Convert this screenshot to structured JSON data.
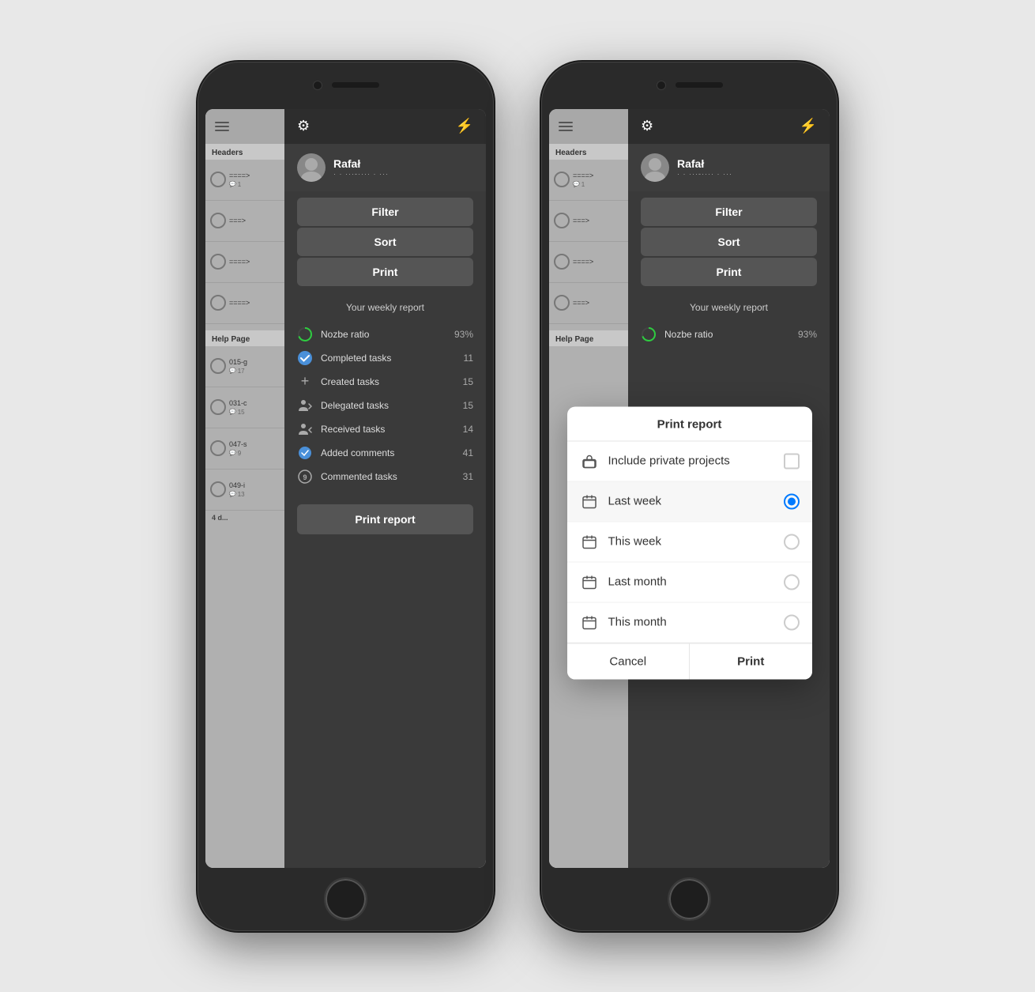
{
  "phone1": {
    "header": {
      "gear_label": "⚙",
      "lightning_label": "⚡"
    },
    "user": {
      "name": "Rafał",
      "email": "· · ···-···· · ···"
    },
    "menu": {
      "filter_label": "Filter",
      "sort_label": "Sort",
      "print_label": "Print"
    },
    "sidebar": {
      "headers_label": "Headers",
      "help_label": "Help Page",
      "items": [
        {
          "title": "====>",
          "count": "1"
        },
        {
          "title": "===>",
          "count": ""
        },
        {
          "title": "====>",
          "count": ""
        },
        {
          "title": "====>",
          "count": ""
        }
      ],
      "bottom_items": [
        {
          "title": "015-g",
          "count": "17"
        },
        {
          "title": "031-c",
          "count": "15"
        },
        {
          "title": "047-s",
          "count": "9"
        },
        {
          "title": "049-i",
          "count": "13"
        }
      ],
      "footer": "4 d..."
    },
    "report": {
      "title": "Your weekly report",
      "items": [
        {
          "icon": "circle-progress",
          "label": "Nozbe ratio",
          "count": "93%",
          "type": "progress"
        },
        {
          "icon": "check",
          "label": "Completed tasks",
          "count": "11",
          "type": "check"
        },
        {
          "icon": "plus",
          "label": "Created tasks",
          "count": "15",
          "type": "plus"
        },
        {
          "icon": "delegate",
          "label": "Delegated tasks",
          "count": "15",
          "type": "person"
        },
        {
          "icon": "receive",
          "label": "Received tasks",
          "count": "14",
          "type": "person-in"
        },
        {
          "icon": "comment-check",
          "label": "Added comments",
          "count": "41",
          "type": "comment-check"
        },
        {
          "icon": "comment",
          "label": "Commented tasks",
          "count": "31",
          "type": "comment-num"
        }
      ],
      "print_report_label": "Print report"
    }
  },
  "phone2": {
    "header": {
      "gear_label": "⚙",
      "lightning_label": "⚡"
    },
    "user": {
      "name": "Rafał",
      "email": "· · ···-···· · ···"
    },
    "menu": {
      "filter_label": "Filter",
      "sort_label": "Sort",
      "print_label": "Print"
    },
    "sidebar": {
      "headers_label": "Headers",
      "help_label": "Help Page",
      "items": [
        {
          "title": "====>",
          "count": "1"
        },
        {
          "title": "===>",
          "count": ""
        },
        {
          "title": "====>",
          "count": ""
        },
        {
          "title": "====>",
          "count": ""
        }
      ]
    },
    "report": {
      "title": "Your weekly report",
      "nozbe_ratio": "93%"
    },
    "dialog": {
      "title": "Print report",
      "include_private": "Include private projects",
      "options": [
        {
          "label": "Last week",
          "selected": true
        },
        {
          "label": "This week",
          "selected": false
        },
        {
          "label": "Last month",
          "selected": false
        },
        {
          "label": "This month",
          "selected": false
        }
      ],
      "cancel_label": "Cancel",
      "print_label": "Print"
    }
  }
}
